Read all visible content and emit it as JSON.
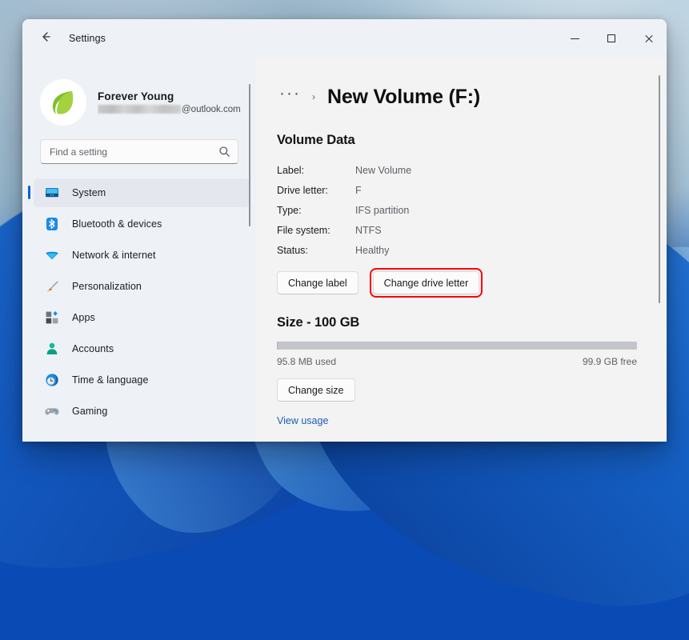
{
  "window": {
    "app_title": "Settings",
    "back_icon": "back-arrow-icon",
    "controls": {
      "minimize": "minimize-icon",
      "maximize": "maximize-icon",
      "close": "close-icon"
    }
  },
  "sidebar": {
    "profile": {
      "name": "Forever Young",
      "email_suffix": "@outlook.com",
      "avatar_icon": "leaf-avatar"
    },
    "search": {
      "placeholder": "Find a setting",
      "value": "",
      "icon": "search-icon"
    },
    "items": [
      {
        "label": "System",
        "icon": "monitor-icon",
        "active": true
      },
      {
        "label": "Bluetooth & devices",
        "icon": "bluetooth-icon",
        "active": false
      },
      {
        "label": "Network & internet",
        "icon": "wifi-icon",
        "active": false
      },
      {
        "label": "Personalization",
        "icon": "brush-icon",
        "active": false
      },
      {
        "label": "Apps",
        "icon": "apps-icon",
        "active": false
      },
      {
        "label": "Accounts",
        "icon": "person-icon",
        "active": false
      },
      {
        "label": "Time & language",
        "icon": "clock-icon",
        "active": false
      },
      {
        "label": "Gaming",
        "icon": "gamepad-icon",
        "active": false
      }
    ]
  },
  "content": {
    "breadcrumb": {
      "overflow": "···",
      "separator": "›",
      "title": "New Volume (F:)"
    },
    "volume_data": {
      "heading": "Volume Data",
      "rows": [
        {
          "key": "Label:",
          "value": "New Volume"
        },
        {
          "key": "Drive letter:",
          "value": "F"
        },
        {
          "key": "Type:",
          "value": "IFS partition"
        },
        {
          "key": "File system:",
          "value": "NTFS"
        },
        {
          "key": "Status:",
          "value": "Healthy"
        }
      ],
      "buttons": {
        "change_label": "Change label",
        "change_drive_letter": "Change drive letter"
      }
    },
    "size": {
      "heading": "Size - 100 GB",
      "used_label": "95.8 MB used",
      "free_label": "99.9 GB free",
      "used_percent": 0.1,
      "change_size_button": "Change size",
      "view_usage_link": "View usage"
    }
  },
  "colors": {
    "accent": "#0a63c9",
    "highlight": "#ff0000",
    "link": "#1b5fb5",
    "window_bg": "#f3f3f3",
    "sidebar_bg": "#eef2f7"
  }
}
